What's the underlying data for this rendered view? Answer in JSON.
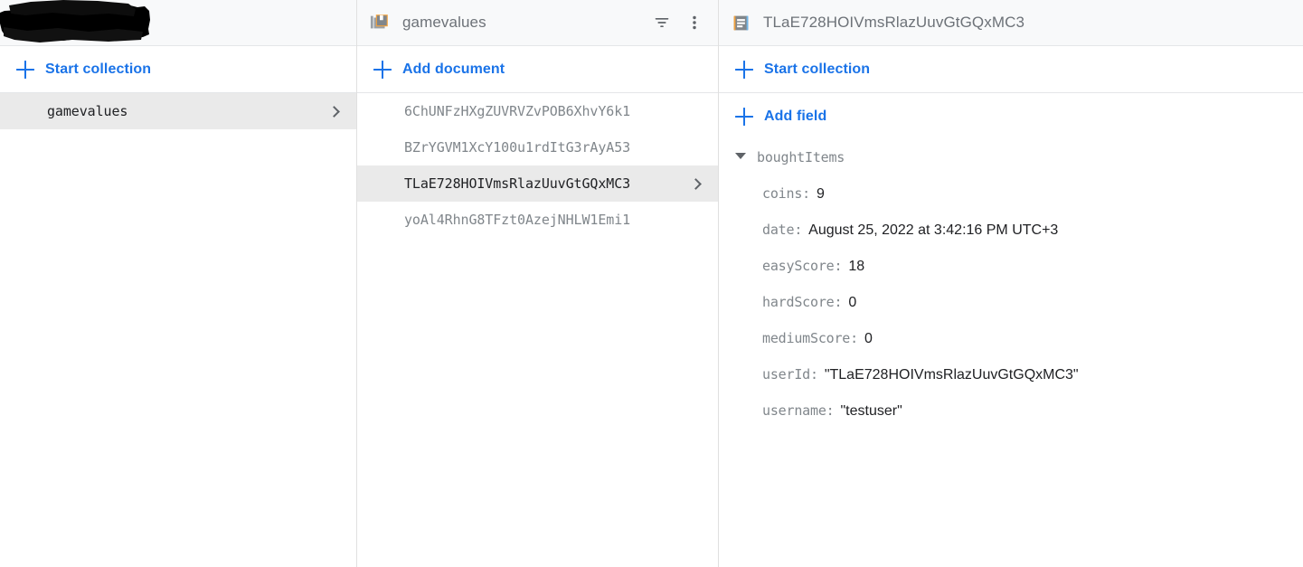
{
  "app": {
    "product": "firestore-data-browser",
    "accent_color": "#1a73e8",
    "selected_row_color": "#eaeaea",
    "header_bg_color": "#f8f9fa"
  },
  "panels": {
    "root": {
      "header_title": "",
      "header_redacted": true,
      "action": {
        "label": "Start collection",
        "icon": "plus-icon"
      },
      "items": [
        {
          "label": "gamevalues",
          "selected": true,
          "chevron": true
        }
      ]
    },
    "collection": {
      "header_title": "gamevalues",
      "header_icon": "collection-icon",
      "actions": {
        "filter": "filter-icon",
        "more": "more-vert-icon"
      },
      "action": {
        "label": "Add document",
        "icon": "plus-icon"
      },
      "documents": [
        {
          "id": "6ChUNFzHXgZUVRVZvPOB6XhvY6k1",
          "selected": false,
          "chevron": false
        },
        {
          "id": "BZrYGVM1XcY100u1rdItG3rAyA53",
          "selected": false,
          "chevron": false
        },
        {
          "id": "TLaE728HOIVmsRlazUuvGtGQxMC3",
          "selected": true,
          "chevron": true
        },
        {
          "id": "yoAl4RhnG8TFzt0AzejNHLW1Emi1",
          "selected": false,
          "chevron": false
        }
      ]
    },
    "document": {
      "header_title": "TLaE728HOIVmsRlazUuvGtGQxMC3",
      "header_icon": "document-icon",
      "action_start_collection": {
        "label": "Start collection",
        "icon": "plus-icon"
      },
      "action_add_field": {
        "label": "Add field",
        "icon": "plus-icon"
      },
      "fields": [
        {
          "key": "boughtItems",
          "value": "",
          "expandable": true,
          "expanded": true
        },
        {
          "key": "coins:",
          "value": "9",
          "expandable": false
        },
        {
          "key": "date:",
          "value": "August 25, 2022 at 3:42:16 PM UTC+3",
          "expandable": false
        },
        {
          "key": "easyScore:",
          "value": "18",
          "expandable": false
        },
        {
          "key": "hardScore:",
          "value": "0",
          "expandable": false
        },
        {
          "key": "mediumScore:",
          "value": "0",
          "expandable": false
        },
        {
          "key": "userId:",
          "value": "\"TLaE728HOIVmsRlazUuvGtGQxMC3\"",
          "expandable": false
        },
        {
          "key": "username:",
          "value": "\"testuser\"",
          "expandable": false
        }
      ]
    }
  }
}
